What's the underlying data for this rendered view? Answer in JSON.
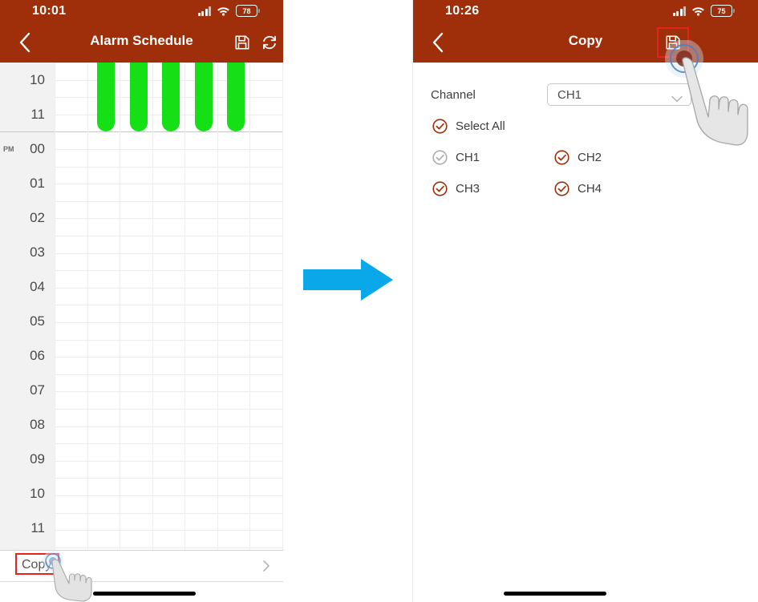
{
  "left_phone": {
    "status_bar": {
      "time": "10:01",
      "battery_level": "78",
      "icons": [
        "cellular-signal-icon",
        "wifi-icon",
        "battery-icon"
      ]
    },
    "nav": {
      "back_icon": "chevron-left-icon",
      "title": "Alarm Schedule",
      "save_icon": "save-floppy-icon",
      "refresh_icon": "refresh-icon"
    },
    "schedule": {
      "am_pm_marker": "PM",
      "hours": [
        "10",
        "11",
        "00",
        "01",
        "02",
        "03",
        "04",
        "05",
        "06",
        "07",
        "08",
        "09",
        "10",
        "11"
      ],
      "bar_color": "#15e015"
    },
    "copy_row": {
      "label": "Copy",
      "chevron_icon": "chevron-right-icon",
      "highlight_color": "#e5231b"
    },
    "touch_indicator": "hand-tap-icon"
  },
  "right_phone": {
    "status_bar": {
      "time": "10:26",
      "battery_level": "75",
      "icons": [
        "cellular-signal-icon",
        "wifi-icon",
        "battery-icon"
      ]
    },
    "nav": {
      "back_icon": "chevron-left-icon",
      "title": "Copy",
      "save_icon": "save-floppy-icon",
      "highlight_color": "#e5231b"
    },
    "channel_field": {
      "label": "Channel",
      "value": "CH1",
      "chevron_icon": "chevron-down-icon"
    },
    "select_all": {
      "label": "Select All",
      "checked": true
    },
    "channels": [
      {
        "label": "CH1",
        "checked": true,
        "disabled": true
      },
      {
        "label": "CH2",
        "checked": true,
        "disabled": false
      },
      {
        "label": "CH3",
        "checked": true,
        "disabled": false
      },
      {
        "label": "CH4",
        "checked": true,
        "disabled": false
      }
    ],
    "touch_indicator": "hand-tap-icon"
  },
  "flow_arrow": {
    "icon": "arrow-right-icon",
    "color": "#0aa8e8"
  },
  "theme": {
    "header_bg": "#9e2f0a",
    "accent_check": "#9e2f0a",
    "disabled_check": "#aaaaaa",
    "bar_green": "#15e015"
  },
  "chart_data": {
    "type": "bar",
    "title": "Alarm Schedule",
    "categories": [
      "10 AM",
      "11 AM",
      "12 PM",
      "01 PM",
      "02 PM",
      "03 PM",
      "04 PM",
      "05 PM",
      "06 PM",
      "07 PM",
      "08 PM",
      "09 PM",
      "10 PM",
      "11 PM"
    ],
    "bars": [
      {
        "col": 2,
        "start_hour": "before-10AM",
        "end_hour": "12PM"
      },
      {
        "col": 3,
        "start_hour": "before-10AM",
        "end_hour": "12PM"
      },
      {
        "col": 4,
        "start_hour": "before-10AM",
        "end_hour": "12PM"
      },
      {
        "col": 5,
        "start_hour": "before-10AM",
        "end_hour": "12PM"
      },
      {
        "col": 6,
        "start_hour": "before-10AM",
        "end_hour": "12PM"
      }
    ]
  }
}
